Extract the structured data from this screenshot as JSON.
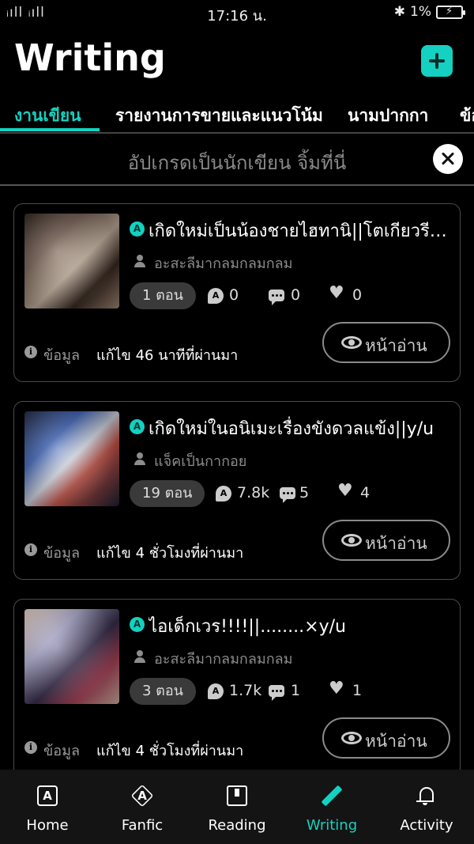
{
  "status_bar": {
    "signal": "ᵢıll ᵢıll",
    "time": "17:16 น.",
    "bluetooth": "bluetooth-icon",
    "battery_percent": "1%"
  },
  "header": {
    "title": "Writing",
    "add_icon": "plus-icon"
  },
  "tabs": [
    {
      "label": "งานเขียน"
    },
    {
      "label": "รายงานการขายและแนวโน้ม"
    },
    {
      "label": "นามปากกา"
    },
    {
      "label": "ข้อ"
    }
  ],
  "banner": {
    "text": "อัปเกรดเป็นนักเขียน จิ้มที่นี่",
    "close_icon": "close-icon"
  },
  "stories": [
    {
      "title": "เกิดใหม่เป็นน้องชายไฮทานิ||โตเกียวรีเวนเจอร์ส",
      "author": "อะสะลีมากลมกลมกลม",
      "episodes": "1 ตอน",
      "views": "0",
      "comments": "0",
      "likes": "0",
      "info_label": "ข้อมูล",
      "edited": "แก้ไข 46 นาทีที่ผ่านมา",
      "read_label": "หน้าอ่าน"
    },
    {
      "title": "เกิดใหม่ในอนิเมะเรื่องขังดวลแข้ง||y/u",
      "author": "แจ็คเป็นกากอย",
      "episodes": "19 ตอน",
      "views": "7.8k",
      "comments": "5",
      "likes": "4",
      "info_label": "ข้อมูล",
      "edited": "แก้ไข 4 ชั่วโมงที่ผ่านมา",
      "read_label": "หน้าอ่าน"
    },
    {
      "title": "ไอเด็กเวร!!!!||........×y/u",
      "author": "อะสะลีมากลมกลมกลม",
      "episodes": "3 ตอน",
      "views": "1.7k",
      "comments": "1",
      "likes": "1",
      "info_label": "ข้อมูล",
      "edited": "แก้ไข 4 ชั่วโมงที่ผ่านมา",
      "read_label": "หน้าอ่าน"
    }
  ],
  "bottom_nav": [
    {
      "label": "Home",
      "icon": "home-icon"
    },
    {
      "label": "Fanfic",
      "icon": "fanfic-icon"
    },
    {
      "label": "Reading",
      "icon": "book-icon"
    },
    {
      "label": "Writing",
      "icon": "pen-icon",
      "active": true
    },
    {
      "label": "Activity",
      "icon": "bell-icon"
    }
  ],
  "colors": {
    "accent": "#14d1c1",
    "background": "#000000",
    "muted_text": "#8c8c8c"
  }
}
